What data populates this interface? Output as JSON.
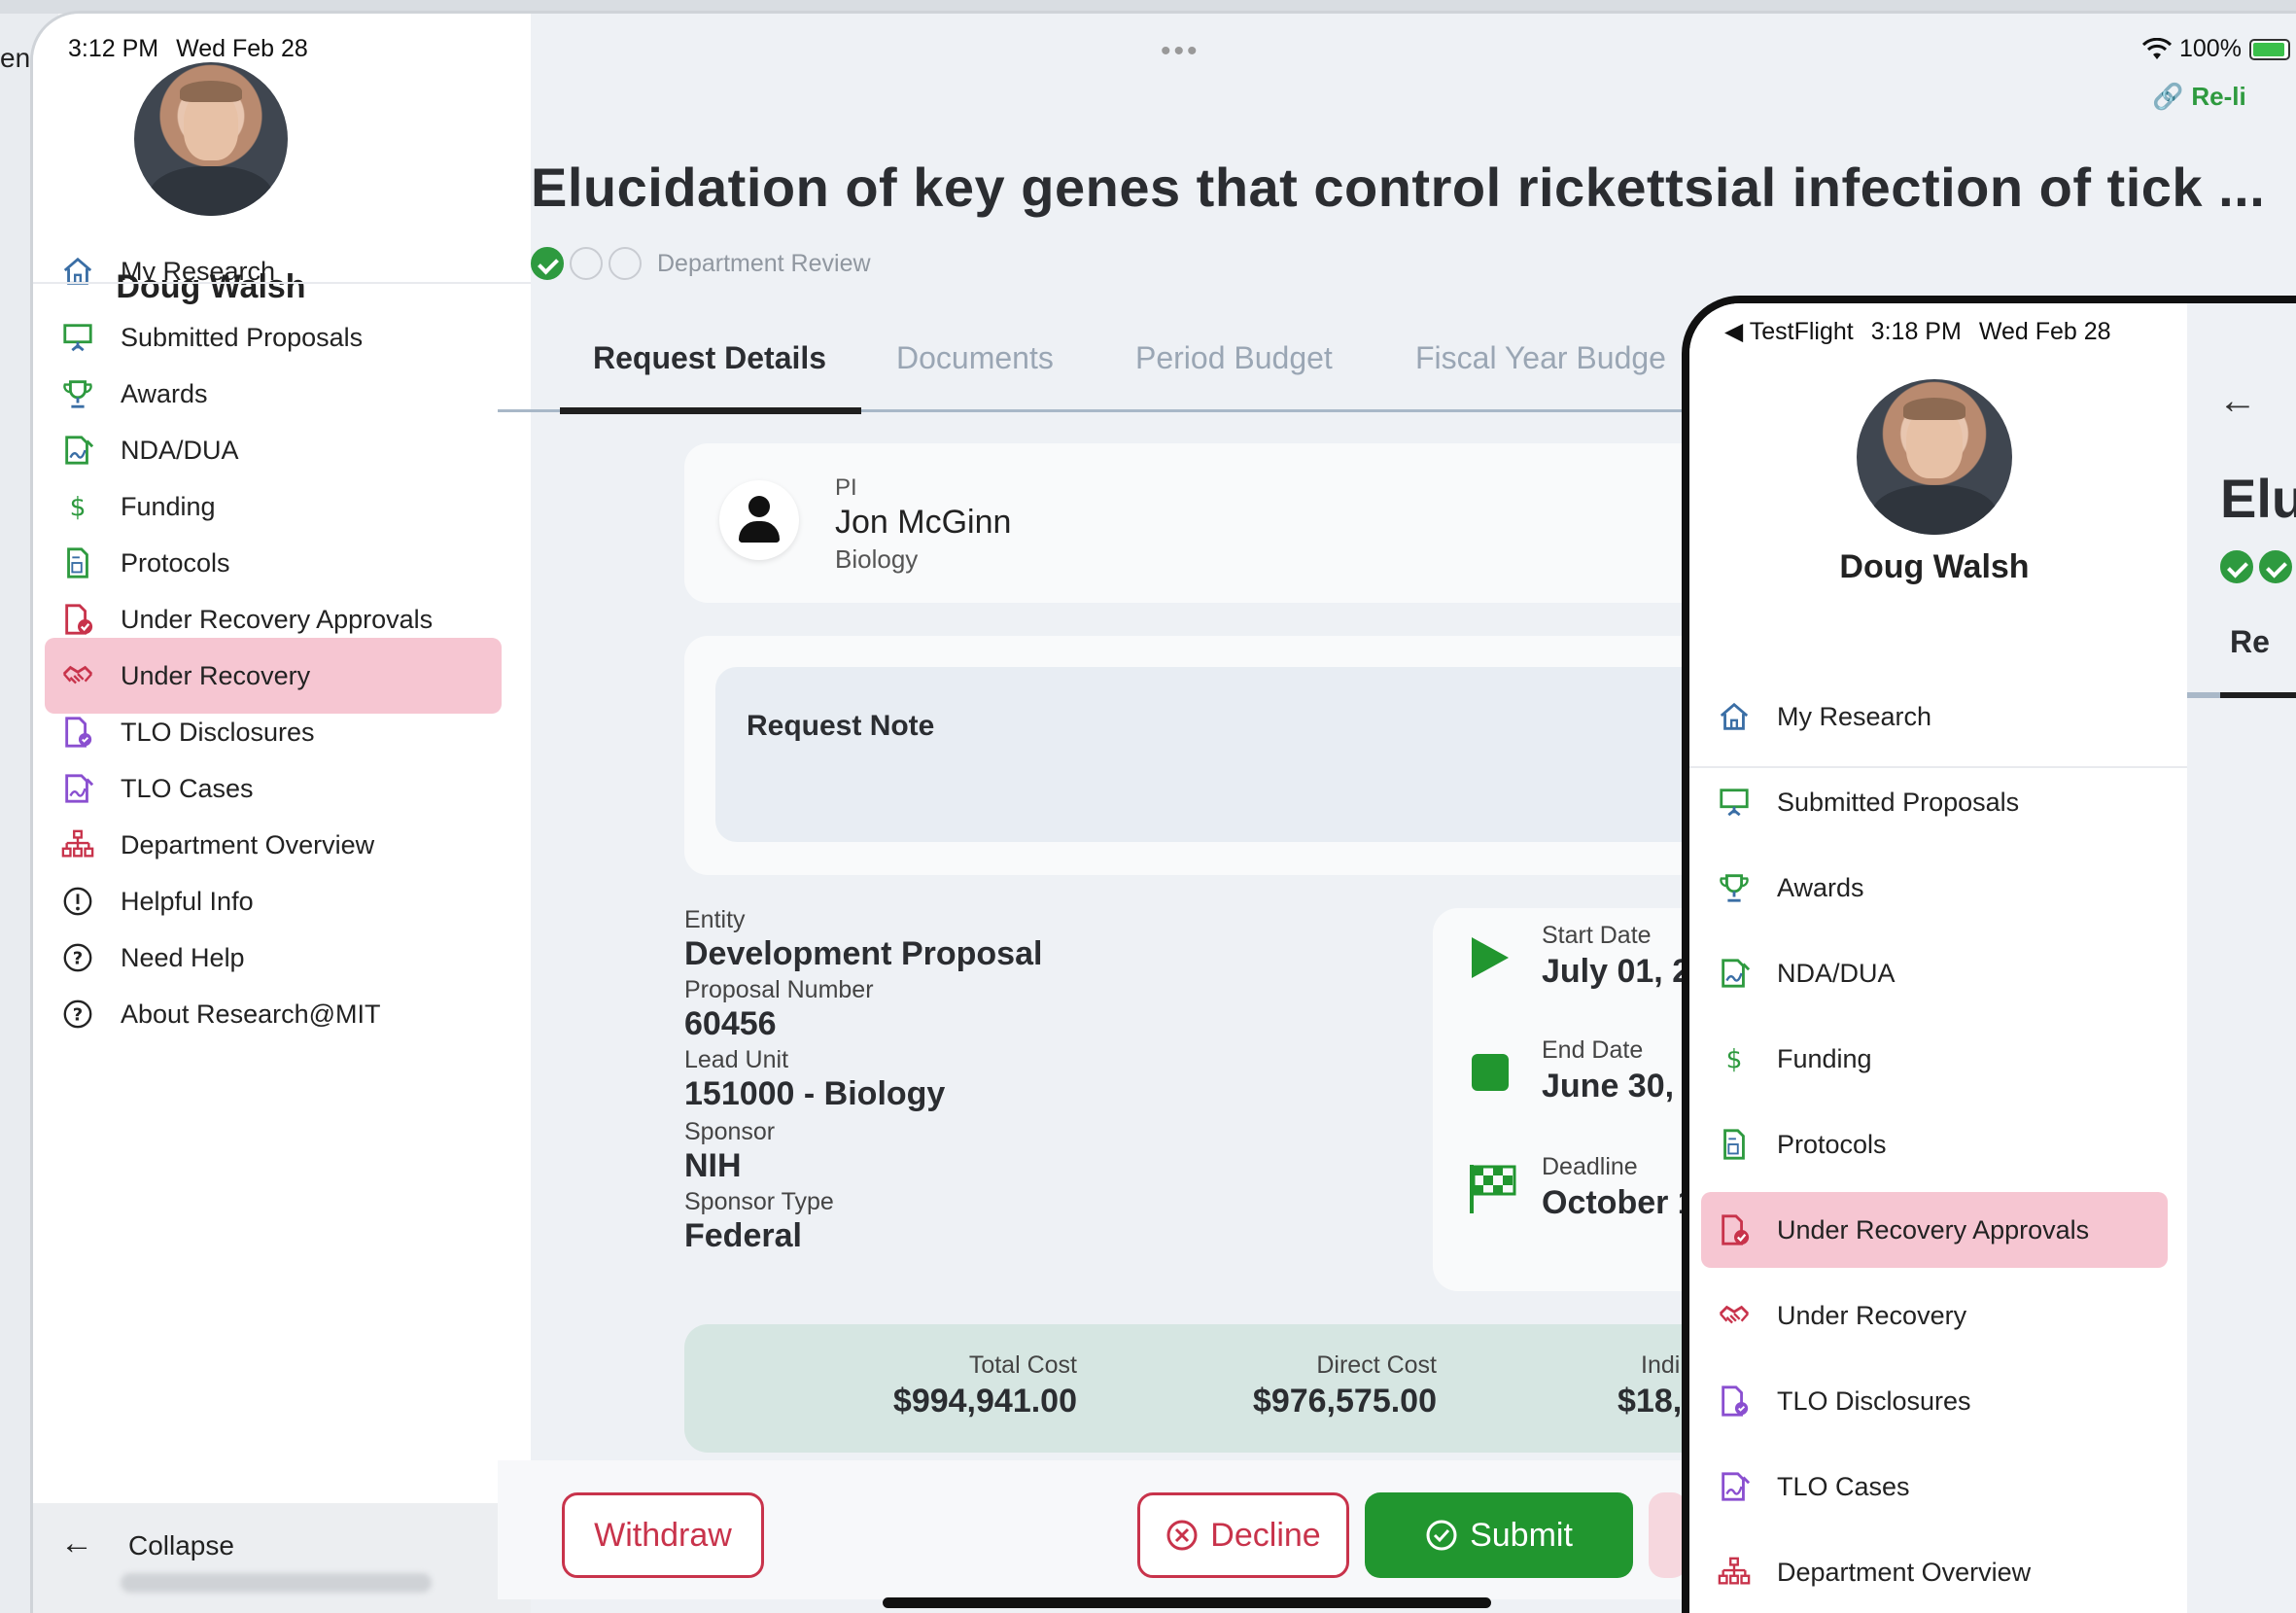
{
  "main": {
    "status": {
      "time": "3:12 PM",
      "date": "Wed Feb 28",
      "battery": "100%"
    },
    "partial_left_text": "ene",
    "user": {
      "name": "Doug Walsh"
    },
    "nav": [
      {
        "label": "My Research",
        "icon": "house-icon"
      },
      {
        "label": "Submitted Proposals",
        "icon": "presentation-icon"
      },
      {
        "label": "Awards",
        "icon": "trophy-icon"
      },
      {
        "label": "NDA/DUA",
        "icon": "signed-document-icon"
      },
      {
        "label": "Funding",
        "icon": "dollar-icon"
      },
      {
        "label": "Protocols",
        "icon": "protocol-document-icon"
      },
      {
        "label": "Under Recovery Approvals",
        "icon": "approval-document-icon"
      },
      {
        "label": "Under Recovery",
        "icon": "handshake-icon"
      },
      {
        "label": "TLO Disclosures",
        "icon": "disclosure-document-icon"
      },
      {
        "label": "TLO Cases",
        "icon": "case-document-icon"
      },
      {
        "label": "Department Overview",
        "icon": "org-chart-icon"
      },
      {
        "label": "Helpful Info",
        "icon": "info-circle-icon"
      },
      {
        "label": "Need Help",
        "icon": "question-circle-icon"
      },
      {
        "label": "About Research@MIT",
        "icon": "question-circle-icon"
      }
    ],
    "active_nav": "Under Recovery",
    "collapse_label": "Collapse",
    "relink_label": "Re-li",
    "title": "Elucidation of key genes that control rickettsial infection of tick ...",
    "workflow": {
      "status_label": "Department Review",
      "steps_done": 1,
      "steps_total": 3
    },
    "tabs": [
      "Request Details",
      "Documents",
      "Period Budget",
      "Fiscal Year Budge"
    ],
    "active_tab": "Request Details",
    "pi": {
      "label": "PI",
      "name": "Jon McGinn",
      "department": "Biology"
    },
    "request_note": {
      "title": "Request Note"
    },
    "details": [
      {
        "label": "Entity",
        "value": "Development Proposal"
      },
      {
        "label": "Proposal Number",
        "value": "60456"
      },
      {
        "label": "Lead Unit",
        "value": "151000 - Biology"
      },
      {
        "label": "Sponsor",
        "value": "NIH"
      },
      {
        "label": "Sponsor Type",
        "value": "Federal"
      }
    ],
    "dates": [
      {
        "label": "Start Date",
        "value": "July 01, 2",
        "icon": "play-icon"
      },
      {
        "label": "End Date",
        "value": "June 30,",
        "icon": "stop-icon"
      },
      {
        "label": "Deadline",
        "value": "October 1",
        "icon": "flag-icon"
      }
    ],
    "costs": [
      {
        "label": "Total Cost",
        "value": "$994,941.00"
      },
      {
        "label": "Direct Cost",
        "value": "$976,575.00"
      },
      {
        "label": "Indi",
        "value": "$18,"
      }
    ],
    "actions": {
      "withdraw": "Withdraw",
      "decline": "Decline",
      "submit": "Submit"
    }
  },
  "second": {
    "status": {
      "back_app": "◀ TestFlight",
      "time": "3:18 PM",
      "date": "Wed Feb 28"
    },
    "user": {
      "name": "Doug Walsh"
    },
    "nav": [
      {
        "label": "My Research"
      },
      {
        "label": "Submitted Proposals"
      },
      {
        "label": "Awards"
      },
      {
        "label": "NDA/DUA"
      },
      {
        "label": "Funding"
      },
      {
        "label": "Protocols"
      },
      {
        "label": "Under Recovery Approvals"
      },
      {
        "label": "Under Recovery"
      },
      {
        "label": "TLO Disclosures"
      },
      {
        "label": "TLO Cases"
      },
      {
        "label": "Department Overview"
      }
    ],
    "active_nav": "Under Recovery Approvals",
    "title_partial": "Elu",
    "tab_partial": "Re"
  },
  "colors": {
    "accent_green": "#21962f",
    "active_nav_bg": "#f6c6d2",
    "decline_red": "#c8334b",
    "cost_bg": "#d6e6e2"
  }
}
